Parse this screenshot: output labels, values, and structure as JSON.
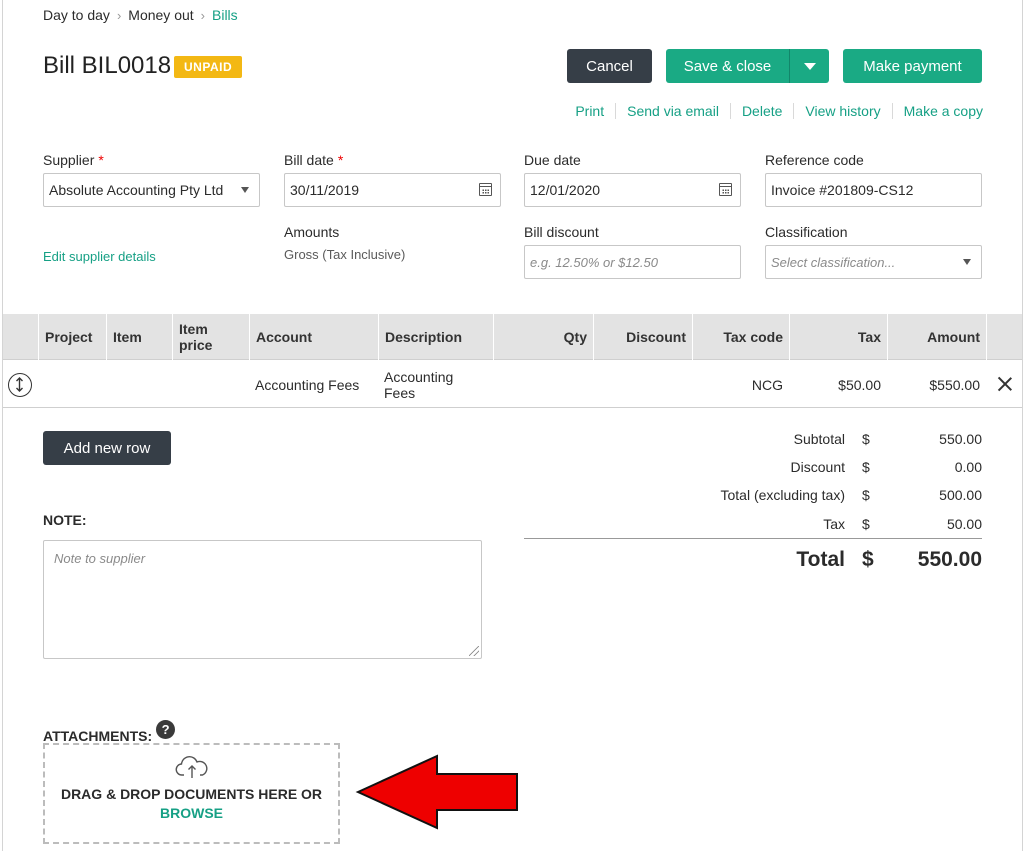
{
  "breadcrumb": {
    "items": [
      "Day to day",
      "Money out",
      "Bills"
    ]
  },
  "header": {
    "title": "Bill BIL0018",
    "status": "UNPAID",
    "buttons": {
      "cancel": "Cancel",
      "save": "Save & close",
      "pay": "Make payment"
    },
    "actions": [
      "Print",
      "Send via email",
      "Delete",
      "View history",
      "Make a copy"
    ]
  },
  "form": {
    "supplier_label": "Supplier",
    "supplier_value": "Absolute Accounting Pty Ltd",
    "edit_supplier": "Edit supplier details",
    "bill_date_label": "Bill date",
    "bill_date_value": "30/11/2019",
    "amounts_label": "Amounts",
    "amounts_value": "Gross (Tax Inclusive)",
    "due_date_label": "Due date",
    "due_date_value": "12/01/2020",
    "discount_label": "Bill discount",
    "discount_placeholder": "e.g. 12.50% or $12.50",
    "reference_label": "Reference code",
    "reference_value": "Invoice #201809-CS12",
    "classification_label": "Classification",
    "classification_placeholder": "Select classification..."
  },
  "table": {
    "headers": [
      "Project",
      "Item",
      "Item price",
      "Account",
      "Description",
      "Qty",
      "Discount",
      "Tax code",
      "Tax",
      "Amount"
    ],
    "rows": [
      {
        "project": "",
        "item": "",
        "item_price": "",
        "account": "Accounting Fees",
        "description": "Accounting Fees",
        "qty": "",
        "discount": "",
        "tax_code": "NCG",
        "tax": "$50.00",
        "amount": "$550.00"
      }
    ],
    "add_row": "Add new row"
  },
  "totals": {
    "currency": "$",
    "subtotal_label": "Subtotal",
    "subtotal": "550.00",
    "discount_label": "Discount",
    "discount": "0.00",
    "excl_label": "Total (excluding tax)",
    "excl": "500.00",
    "tax_label": "Tax",
    "tax": "50.00",
    "total_label": "Total",
    "total": "550.00"
  },
  "note": {
    "label": "NOTE:",
    "placeholder": "Note to supplier"
  },
  "attachments": {
    "label": "ATTACHMENTS:",
    "help": "?",
    "drop_text": "DRAG & DROP DOCUMENTS HERE OR",
    "browse": "BROWSE"
  },
  "colors": {
    "accent": "#1aaa84",
    "dark": "#363e47",
    "badge": "#f3b814",
    "arrow": "#ee0000"
  }
}
